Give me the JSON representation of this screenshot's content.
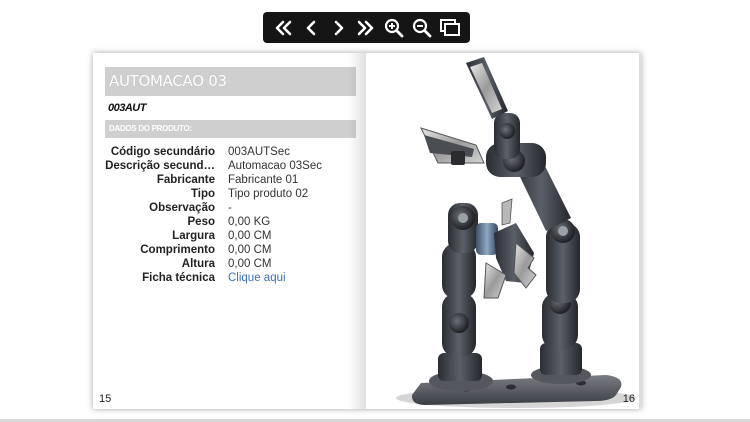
{
  "toolbar": {
    "buttons": [
      {
        "name": "first-page-button",
        "icon": "double-chevron-left-icon"
      },
      {
        "name": "previous-page-button",
        "icon": "chevron-left-icon"
      },
      {
        "name": "next-page-button",
        "icon": "chevron-right-icon"
      },
      {
        "name": "last-page-button",
        "icon": "double-chevron-right-icon"
      },
      {
        "name": "zoom-in-button",
        "icon": "zoom-in-icon"
      },
      {
        "name": "zoom-out-button",
        "icon": "zoom-out-icon"
      },
      {
        "name": "fullscreen-button",
        "icon": "fullscreen-icon"
      }
    ]
  },
  "left_page": {
    "title": "AUTOMACAO 03",
    "code": "003AUT",
    "section_title": "DADOS DO PRODUTO:",
    "details": [
      {
        "label": "Código secundário",
        "value": "003AUTSec"
      },
      {
        "label": "Descrição secund…",
        "value": "Automacao 03Sec"
      },
      {
        "label": "Fabricante",
        "value": "Fabricante 01"
      },
      {
        "label": "Tipo",
        "value": "Tipo produto 02"
      },
      {
        "label": "Observação",
        "value": "-"
      },
      {
        "label": "Peso",
        "value": "0,00 KG"
      },
      {
        "label": "Largura",
        "value": "0,00 CM"
      },
      {
        "label": "Comprimento",
        "value": "0,00 CM"
      },
      {
        "label": "Altura",
        "value": "0,00 CM"
      }
    ],
    "datasheet": {
      "label": "Ficha técnica",
      "link_text": "Clique aqui"
    },
    "page_number": "15"
  },
  "right_page": {
    "image": "robotic-arm-product-photo",
    "page_number": "16"
  },
  "colors": {
    "toolbar_bg": "#151515",
    "header_bar": "#cfcfcf",
    "link": "#3f6fb6"
  }
}
